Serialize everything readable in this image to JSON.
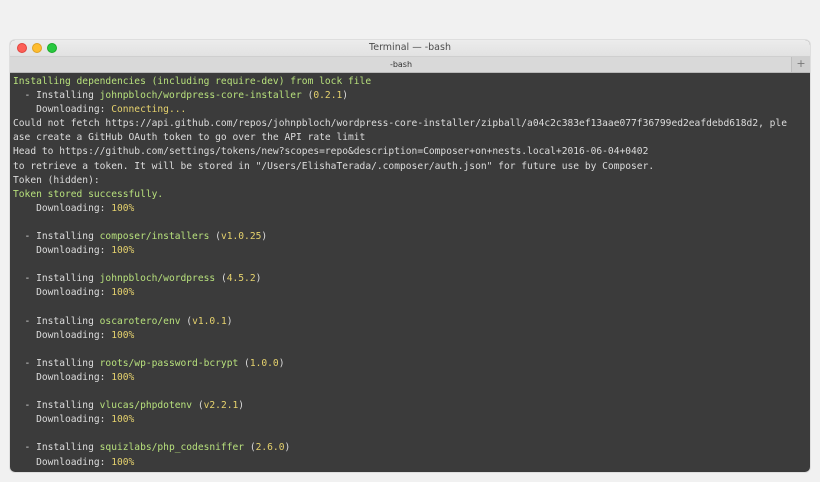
{
  "window": {
    "title": "Terminal — -bash",
    "tab_label": "-bash",
    "new_tab_symbol": "+"
  },
  "colors": {
    "background": "#3b3b3b",
    "text": "#dcdcdc",
    "green": "#b7e07c",
    "yellow": "#e6d26d"
  },
  "lines": [
    {
      "segments": [
        {
          "t": "Installing dependencies (including require-dev) from lock file",
          "c": "g"
        }
      ]
    },
    {
      "segments": [
        {
          "t": "  - Installing ",
          "c": "w"
        },
        {
          "t": "johnpbloch/wordpress-core-installer",
          "c": "g"
        },
        {
          "t": " (",
          "c": "w"
        },
        {
          "t": "0.2.1",
          "c": "y"
        },
        {
          "t": ")",
          "c": "w"
        }
      ]
    },
    {
      "segments": [
        {
          "t": "    Downloading: ",
          "c": "w"
        },
        {
          "t": "Connecting...",
          "c": "y"
        }
      ]
    },
    {
      "segments": [
        {
          "t": "Could not fetch https://api.github.com/repos/johnpbloch/wordpress-core-installer/zipball/a04c2c383ef13aae077f36799ed2eafdebd618d2, ple",
          "c": "w"
        }
      ]
    },
    {
      "segments": [
        {
          "t": "ase create a GitHub OAuth token to go over the API rate limit",
          "c": "w"
        }
      ]
    },
    {
      "segments": [
        {
          "t": "Head to https://github.com/settings/tokens/new?scopes=repo&description=Composer+on+nests.local+2016-06-04+0402",
          "c": "w"
        }
      ]
    },
    {
      "segments": [
        {
          "t": "to retrieve a token. It will be stored in \"/Users/ElishaTerada/.composer/auth.json\" for future use by Composer.",
          "c": "w"
        }
      ]
    },
    {
      "segments": [
        {
          "t": "Token (hidden):",
          "c": "w"
        }
      ]
    },
    {
      "segments": [
        {
          "t": "Token stored successfully.",
          "c": "g"
        }
      ]
    },
    {
      "segments": [
        {
          "t": "    Downloading: ",
          "c": "w"
        },
        {
          "t": "100%",
          "c": "y"
        }
      ]
    },
    {
      "segments": []
    },
    {
      "segments": [
        {
          "t": "  - Installing ",
          "c": "w"
        },
        {
          "t": "composer/installers",
          "c": "g"
        },
        {
          "t": " (",
          "c": "w"
        },
        {
          "t": "v1.0.25",
          "c": "y"
        },
        {
          "t": ")",
          "c": "w"
        }
      ]
    },
    {
      "segments": [
        {
          "t": "    Downloading: ",
          "c": "w"
        },
        {
          "t": "100%",
          "c": "y"
        }
      ]
    },
    {
      "segments": []
    },
    {
      "segments": [
        {
          "t": "  - Installing ",
          "c": "w"
        },
        {
          "t": "johnpbloch/wordpress",
          "c": "g"
        },
        {
          "t": " (",
          "c": "w"
        },
        {
          "t": "4.5.2",
          "c": "y"
        },
        {
          "t": ")",
          "c": "w"
        }
      ]
    },
    {
      "segments": [
        {
          "t": "    Downloading: ",
          "c": "w"
        },
        {
          "t": "100%",
          "c": "y"
        }
      ]
    },
    {
      "segments": []
    },
    {
      "segments": [
        {
          "t": "  - Installing ",
          "c": "w"
        },
        {
          "t": "oscarotero/env",
          "c": "g"
        },
        {
          "t": " (",
          "c": "w"
        },
        {
          "t": "v1.0.1",
          "c": "y"
        },
        {
          "t": ")",
          "c": "w"
        }
      ]
    },
    {
      "segments": [
        {
          "t": "    Downloading: ",
          "c": "w"
        },
        {
          "t": "100%",
          "c": "y"
        }
      ]
    },
    {
      "segments": []
    },
    {
      "segments": [
        {
          "t": "  - Installing ",
          "c": "w"
        },
        {
          "t": "roots/wp-password-bcrypt",
          "c": "g"
        },
        {
          "t": " (",
          "c": "w"
        },
        {
          "t": "1.0.0",
          "c": "y"
        },
        {
          "t": ")",
          "c": "w"
        }
      ]
    },
    {
      "segments": [
        {
          "t": "    Downloading: ",
          "c": "w"
        },
        {
          "t": "100%",
          "c": "y"
        }
      ]
    },
    {
      "segments": []
    },
    {
      "segments": [
        {
          "t": "  - Installing ",
          "c": "w"
        },
        {
          "t": "vlucas/phpdotenv",
          "c": "g"
        },
        {
          "t": " (",
          "c": "w"
        },
        {
          "t": "v2.2.1",
          "c": "y"
        },
        {
          "t": ")",
          "c": "w"
        }
      ]
    },
    {
      "segments": [
        {
          "t": "    Downloading: ",
          "c": "w"
        },
        {
          "t": "100%",
          "c": "y"
        }
      ]
    },
    {
      "segments": []
    },
    {
      "segments": [
        {
          "t": "  - Installing ",
          "c": "w"
        },
        {
          "t": "squizlabs/php_codesniffer",
          "c": "g"
        },
        {
          "t": " (",
          "c": "w"
        },
        {
          "t": "2.6.0",
          "c": "y"
        },
        {
          "t": ")",
          "c": "w"
        }
      ]
    },
    {
      "segments": [
        {
          "t": "    Downloading: ",
          "c": "w"
        },
        {
          "t": "100%",
          "c": "y"
        }
      ]
    }
  ]
}
